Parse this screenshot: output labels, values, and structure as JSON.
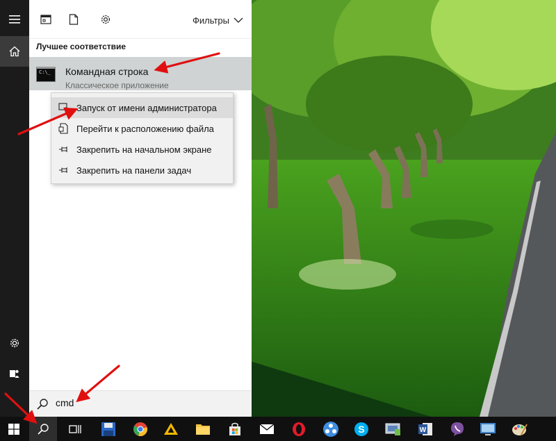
{
  "panel": {
    "filters_label": "Фильтры",
    "best_match_header": "Лучшее соответствие",
    "result": {
      "title": "Командная строка",
      "subtitle": "Классическое приложение",
      "icon": "cmd-console-icon",
      "icon_text": "C:\\_"
    },
    "context_menu": {
      "items": [
        {
          "label": "Запуск от имени администратора",
          "icon": "shield-icon"
        },
        {
          "label": "Перейти к расположению файла",
          "icon": "file-location-icon"
        },
        {
          "label": "Закрепить на начальном экране",
          "icon": "pin-icon"
        },
        {
          "label": "Закрепить на панели задач",
          "icon": "pin-icon"
        }
      ]
    }
  },
  "search": {
    "query": "cmd"
  },
  "rail": {
    "items": [
      "hamburger-icon",
      "home-icon",
      "settings-icon",
      "user-icon"
    ]
  },
  "taskbar": {
    "items": [
      "windows-start-icon",
      "search-icon",
      "task-view-icon",
      "floppy-disk-icon",
      "chrome-icon",
      "yandex-disk-icon",
      "file-explorer-icon",
      "store-icon",
      "mail-icon",
      "opera-icon",
      "network-icon",
      "skype-icon",
      "control-panel-icon",
      "word-icon",
      "viber-icon",
      "remote-desktop-icon",
      "paint-icon"
    ]
  },
  "colors": {
    "accent_arrow": "#e01010",
    "panel_bg": "#ffffff",
    "selected_row": "#cfd3d3",
    "rail_bg": "#1b1b1b",
    "taskbar_bg": "#101010"
  }
}
